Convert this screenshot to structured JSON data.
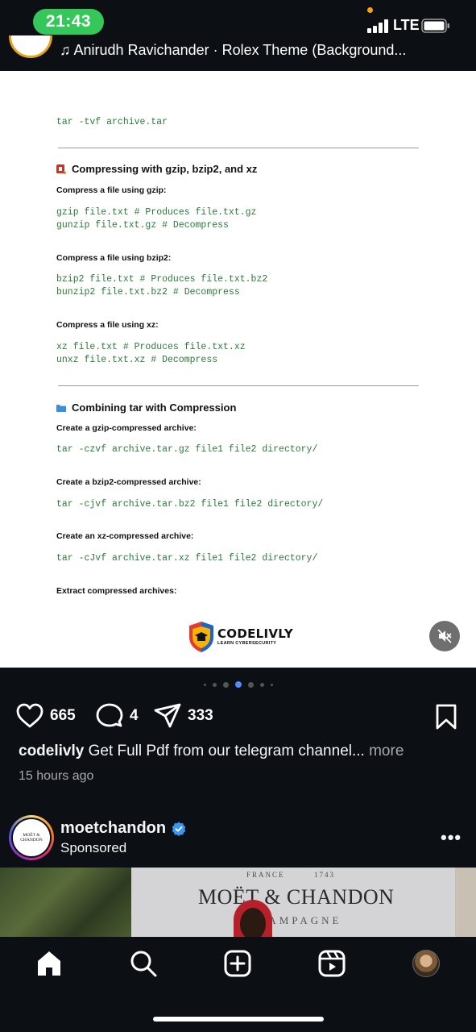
{
  "status_bar": {
    "time": "21:43",
    "network": "LTE"
  },
  "reel_header": {
    "audio_text": "♫ Anirudh Ravichander · Rolex Theme (Background..."
  },
  "document": {
    "cmd_list": "tar -tvf archive.tar",
    "section1_title": "Compressing with gzip, bzip2, and xz",
    "gzip_sub": "Compress a file using gzip:",
    "gzip_code1": "gzip file.txt # Produces file.txt.gz",
    "gzip_code2": "gunzip file.txt.gz # Decompress",
    "bzip2_sub": "Compress a file using bzip2:",
    "bzip2_code1": "bzip2 file.txt # Produces file.txt.bz2",
    "bzip2_code2": "bunzip2 file.txt.bz2 # Decompress",
    "xz_sub": "Compress a file using xz:",
    "xz_code1": "xz file.txt # Produces file.txt.xz",
    "xz_code2": "unxz file.txt.xz # Decompress",
    "section2_title": "Combining tar with Compression",
    "gz_archive_sub": "Create a gzip-compressed archive:",
    "gz_archive_code": "tar -czvf archive.tar.gz file1 file2 directory/",
    "bz2_archive_sub": "Create a bzip2-compressed archive:",
    "bz2_archive_code": "tar -cjvf archive.tar.bz2 file1 file2 directory/",
    "xz_archive_sub": "Create an xz-compressed archive:",
    "xz_archive_code": "tar -cJvf archive.tar.xz file1 file2 directory/",
    "extract_sub": "Extract compressed archives:",
    "logo_name": "CODELIVLY",
    "logo_tagline": "LEARN CYBERSECURITY"
  },
  "carousel": {
    "total": 7,
    "active_index": 3
  },
  "actions": {
    "likes": "665",
    "comments": "4",
    "shares": "333"
  },
  "caption": {
    "username": "codelivly",
    "text": "Get Full Pdf from our telegram channel...",
    "more": "more",
    "time_ago": "15 hours ago"
  },
  "sponsored": {
    "avatar_text": "MOËT & CHANDON",
    "username": "moetchandon",
    "label": "Sponsored",
    "ad_france": "FRANCE",
    "ad_year": "1743",
    "ad_brand": "MOËT & CHANDON",
    "ad_champagne": "HAMPAGNE"
  },
  "colors": {
    "background": "#0c1014",
    "status_green": "#34c759",
    "code_green": "#2c7a3a",
    "verified_blue": "#3897f0",
    "active_dot": "#4f8cff"
  }
}
